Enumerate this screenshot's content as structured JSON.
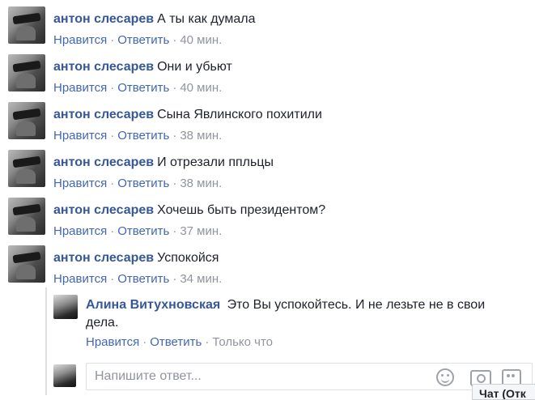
{
  "comments": [
    {
      "author": "антон слесарев",
      "text": "А ты как думала",
      "like": "Нравится",
      "reply": "Ответить",
      "time": "40 мин."
    },
    {
      "author": "антон слесарев",
      "text": "Они и убьют",
      "like": "Нравится",
      "reply": "Ответить",
      "time": "40 мин."
    },
    {
      "author": "антон слесарев",
      "text": "Сына Явлинского похитили",
      "like": "Нравится",
      "reply": "Ответить",
      "time": "38 мин."
    },
    {
      "author": "антон слесарев",
      "text": "И отрезали ппльцы",
      "like": "Нравится",
      "reply": "Ответить",
      "time": "38 мин."
    },
    {
      "author": "антон слесарев",
      "text": "Хочешь быть президентом?",
      "like": "Нравится",
      "reply": "Ответить",
      "time": "37 мин."
    },
    {
      "author": "антон слесарев",
      "text": "Успокойся",
      "like": "Нравится",
      "reply": "Ответить",
      "time": "34 мин."
    }
  ],
  "reply": {
    "author": "Алина Витухновская",
    "text": "Это Вы успокойтесь. И не лезьте не в свои дела.",
    "like": "Нравится",
    "reply": "Ответить",
    "time": "Только что"
  },
  "composer": {
    "placeholder": "Напишите ответ...",
    "icons": [
      "emoji-icon",
      "camera-icon",
      "gif-icon"
    ]
  },
  "chat_tab": {
    "label": "Чат (Отк"
  },
  "separator": "·",
  "colors": {
    "link": "#4267b2",
    "author": "#365899",
    "meta": "#90949c",
    "text": "#1d2129"
  }
}
